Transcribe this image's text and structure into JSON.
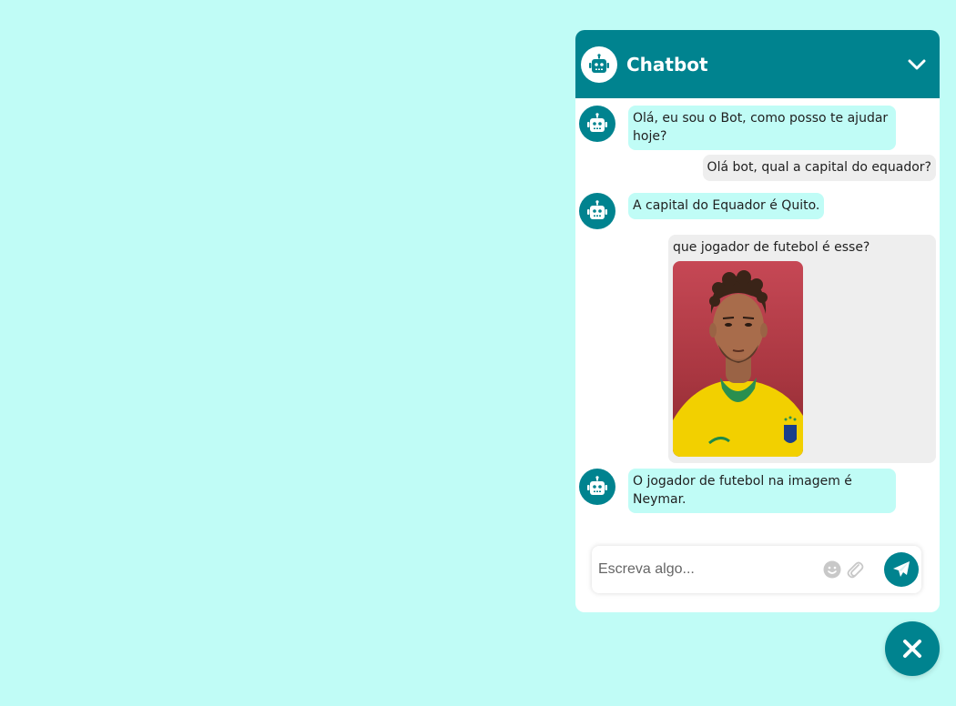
{
  "chatbot": {
    "title": "Chatbot",
    "header_avatar_icon": "robot-icon",
    "collapse_icon": "chevron-down-icon"
  },
  "messages": [
    {
      "sender": "bot",
      "text": "Olá, eu sou o Bot, como posso te ajudar hoje?"
    },
    {
      "sender": "user",
      "text": "Olá bot, qual a capital do equador?"
    },
    {
      "sender": "bot",
      "text": "A capital do Equador é Quito."
    },
    {
      "sender": "user",
      "text": "que jogador de futebol é esse?",
      "attachment": "image"
    },
    {
      "sender": "bot",
      "text": "O jogador de futebol na imagem é Neymar."
    }
  ],
  "composer": {
    "placeholder": "Escreva algo...",
    "emoji_icon": "emoji-icon",
    "attach_icon": "paperclip-icon",
    "send_icon": "send-icon"
  },
  "fab": {
    "icon": "close-icon"
  },
  "colors": {
    "page_background": "#c0fcf6",
    "accent": "#00838f",
    "bot_bubble": "#c0fcf6",
    "user_bubble": "#eeeeee",
    "panel": "#ffffff"
  }
}
